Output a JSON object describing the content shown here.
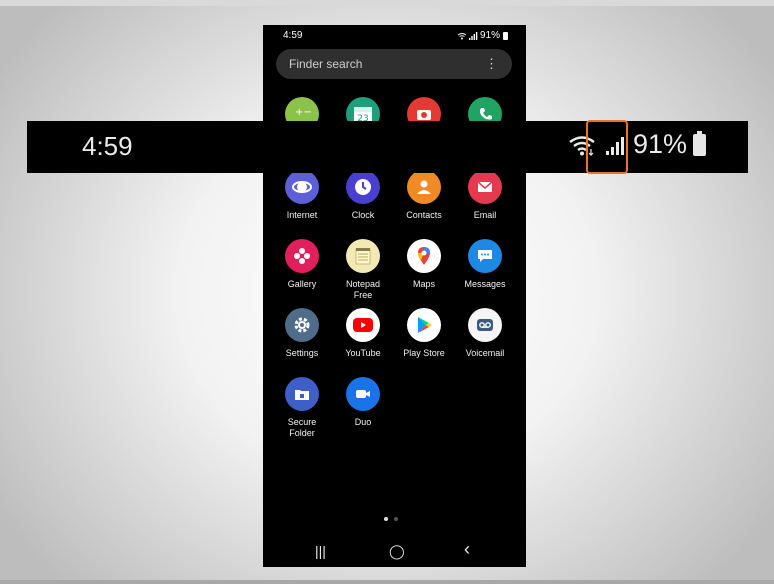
{
  "status": {
    "time": "4:59",
    "battery": "91%"
  },
  "search": {
    "placeholder": "Finder search",
    "menu_icon": "⋮"
  },
  "apps": [
    {
      "label": "Internet",
      "icon": "internet-icon"
    },
    {
      "label": "Clock",
      "icon": "clock-icon"
    },
    {
      "label": "Contacts",
      "icon": "contacts-icon"
    },
    {
      "label": "Email",
      "icon": "email-icon"
    },
    {
      "label": "Gallery",
      "icon": "gallery-icon"
    },
    {
      "label": "Notepad\nFree",
      "icon": "notepad-icon"
    },
    {
      "label": "Maps",
      "icon": "maps-icon"
    },
    {
      "label": "Messages",
      "icon": "messages-icon"
    },
    {
      "label": "Settings",
      "icon": "settings-icon"
    },
    {
      "label": "YouTube",
      "icon": "youtube-icon"
    },
    {
      "label": "Play Store",
      "icon": "play-store-icon"
    },
    {
      "label": "Voicemail",
      "icon": "voicemail-icon"
    },
    {
      "label": "Secure\nFolder",
      "icon": "secure-folder-icon"
    },
    {
      "label": "Duo",
      "icon": "duo-icon"
    }
  ],
  "calendar_day": "23",
  "nav": {
    "recents": "|||",
    "home": "◯",
    "back": "‹"
  },
  "zoom": {
    "time": "4:59",
    "battery": "91%"
  },
  "colors": {
    "highlight": "#e8742a",
    "phone_bg": "#000000"
  }
}
